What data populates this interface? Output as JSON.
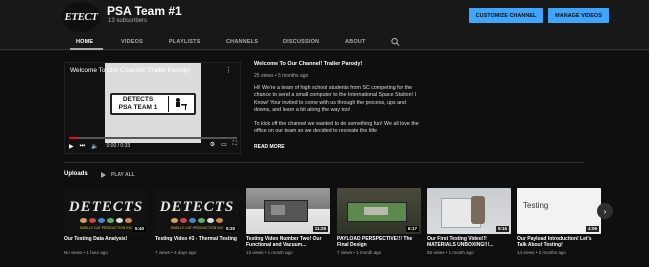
{
  "channel": {
    "avatar_text": "ETECT",
    "name": "PSA Team #1",
    "subscribers": "13 subscribers",
    "customize_label": "CUSTOMIZE CHANNEL",
    "manage_label": "MANAGE VIDEOS"
  },
  "tabs": [
    "HOME",
    "VIDEOS",
    "PLAYLISTS",
    "CHANNELS",
    "DISCUSSION",
    "ABOUT"
  ],
  "featured": {
    "player_title": "Welcome To Our Channel! Trailer Parody!",
    "badge_line1": "DETECTS",
    "badge_line2": "PSA TEAM 1",
    "time": "0:00 / 0:33",
    "title": "Welcome To Our Channel! Trailer Parody!",
    "meta": "25 views • 5 months ago",
    "paragraph1": "Hi! We're a team of high school students from SC competing for the chance to send a small computer to the International Space Station! I Know! Your invited to come with us through the process, ups and downs, and learn a bit along the way too!",
    "paragraph2": "To kick off the channel we wanted to do something fun! We all love the office on our team so we decided to recreate the title",
    "read_more": "READ MORE",
    "progress": 0.05
  },
  "uploads": {
    "title": "Uploads",
    "play_all": "PLAY ALL",
    "videos": [
      {
        "thumb": "detects",
        "strip": "SMELLY CAT PRODUCTION INC",
        "duration": "5:40",
        "title": "Our Testing Data Analysis!",
        "meta": "No views • 1 hour ago"
      },
      {
        "thumb": "detects",
        "strip": "SMELLY CAT PRODUCTION INC",
        "duration": "5:20",
        "title": "Testing Video #3 - Thermal Testing",
        "meta": "7 views • 4 days ago"
      },
      {
        "thumb": "lab",
        "duration": "11:29",
        "title": "Testing Video Number Two! Our Functional and Vacuum...",
        "meta": "13 views • 1 month ago"
      },
      {
        "thumb": "board",
        "duration": "6:17",
        "title": "PAYLOAD PERSPECTIVE!!! The Final Design",
        "meta": "7 views • 1 month ago"
      },
      {
        "thumb": "unbox",
        "duration": "9:15",
        "title": "Our First Testing Video!!! MATERIALS UNBOXING!!!...",
        "meta": "55 views • 1 month ago"
      },
      {
        "thumb": "intro",
        "thumb_text": "Testing",
        "duration": "4:06",
        "title": "Our Payload Introduction! Let's Talk About Testing!",
        "meta": "14 views • 2 months ago"
      }
    ]
  },
  "icons": {
    "search": "search-icon",
    "next": "chevron-right-icon"
  },
  "colors": {
    "accent": "#3ea6ff",
    "background": "#0f0f0f",
    "header": "#181818",
    "progress": "#ff0000"
  }
}
